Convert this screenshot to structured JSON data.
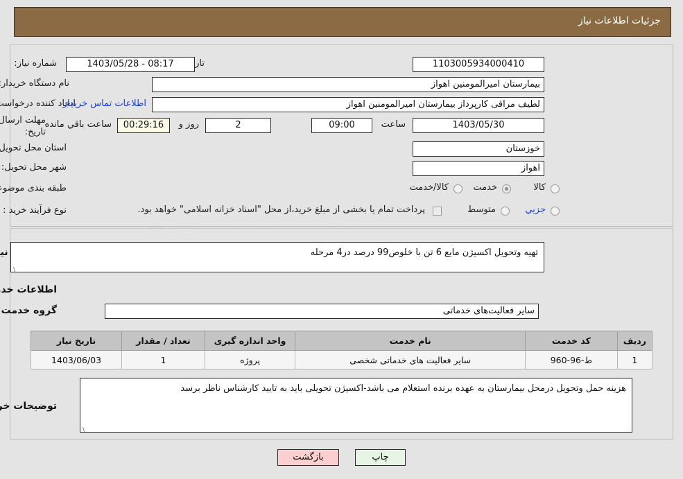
{
  "header": {
    "title": "جزئیات اطلاعات نیاز"
  },
  "form": {
    "need_number_label": "شماره نیاز:",
    "need_number_value": "1103005934000410",
    "announce_label": "تاریخ و ساعت اعلان عمومی:",
    "announce_value": "1403/05/28 - 08:17",
    "buyer_org_label": "نام دستگاه خریدار:",
    "buyer_org_value": "بیمارستان امیرالمومنین اهواز",
    "creator_label": "ایجاد کننده درخواست:",
    "creator_value": "لطیف مراقی کارپرداز بیمارستان امیرالمومنین اهواز",
    "contact_link": "اطلاعات تماس خریدار",
    "deadline_label": "مهلت ارسال پاسخ: تا تاریخ:",
    "deadline_date": "1403/05/30",
    "hour_label": "ساعت",
    "deadline_time": "09:00",
    "days_value": "2",
    "days_label": "روز و",
    "timer_value": "00:29:16",
    "remaining_label": "ساعت باقي مانده",
    "province_label": "استان محل تحویل:",
    "province_value": "خوزستان",
    "city_label": "شهر محل تحویل:",
    "city_value": "اهواز",
    "category_label": "طبقه بندی موضوعی:",
    "category_options": [
      "کالا",
      "خدمت",
      "کالا/خدمت"
    ],
    "category_selected": "خدمت",
    "process_label": "نوع فرآیند خرید :",
    "process_options": [
      "جزیي",
      "متوسط"
    ],
    "process_selected": "جزیي",
    "treasury_note": "پرداخت تمام یا بخشی از مبلغ خرید،از محل \"اسناد خزانه اسلامی\" خواهد بود."
  },
  "summary": {
    "label": "شرح کلي نیاز:",
    "value": "تهیه وتحویل اکسیژن مایع 6 تن  با خلوص99 درصد در4 مرحله"
  },
  "services": {
    "section_title": "اطلاعات خدمات مورد نیاز",
    "group_label": "گروه خدمت:",
    "group_value": "سایر فعالیت‌های خدماتی",
    "table": {
      "headers": [
        "ردیف",
        "کد خدمت",
        "نام خدمت",
        "واحد اندازه گیری",
        "تعداد / مقدار",
        "تاریخ نیاز"
      ],
      "rows": [
        [
          "1",
          "ط-96-960",
          "سایر فعالیت های خدماتی شخصی",
          "پروژه",
          "1",
          "1403/06/03"
        ]
      ]
    }
  },
  "notes": {
    "label": "توضیحات خریدار:",
    "value": "هزینه حمل وتحویل درمحل بیمارستان به عهده برنده استعلام می باشد-اکسیژن تحویلی باید به تایید کارشناس ناظر برسد"
  },
  "buttons": {
    "print": "چاپ",
    "back": "بازگشت"
  },
  "watermark": {
    "text": "naTender.net"
  },
  "colors": {
    "header_bg": "#8a6b43",
    "link": "#1b3fdd",
    "timer_bg": "#fbfbe7",
    "print_bg": "#e7f6e4",
    "back_bg": "#fbcfcf"
  }
}
